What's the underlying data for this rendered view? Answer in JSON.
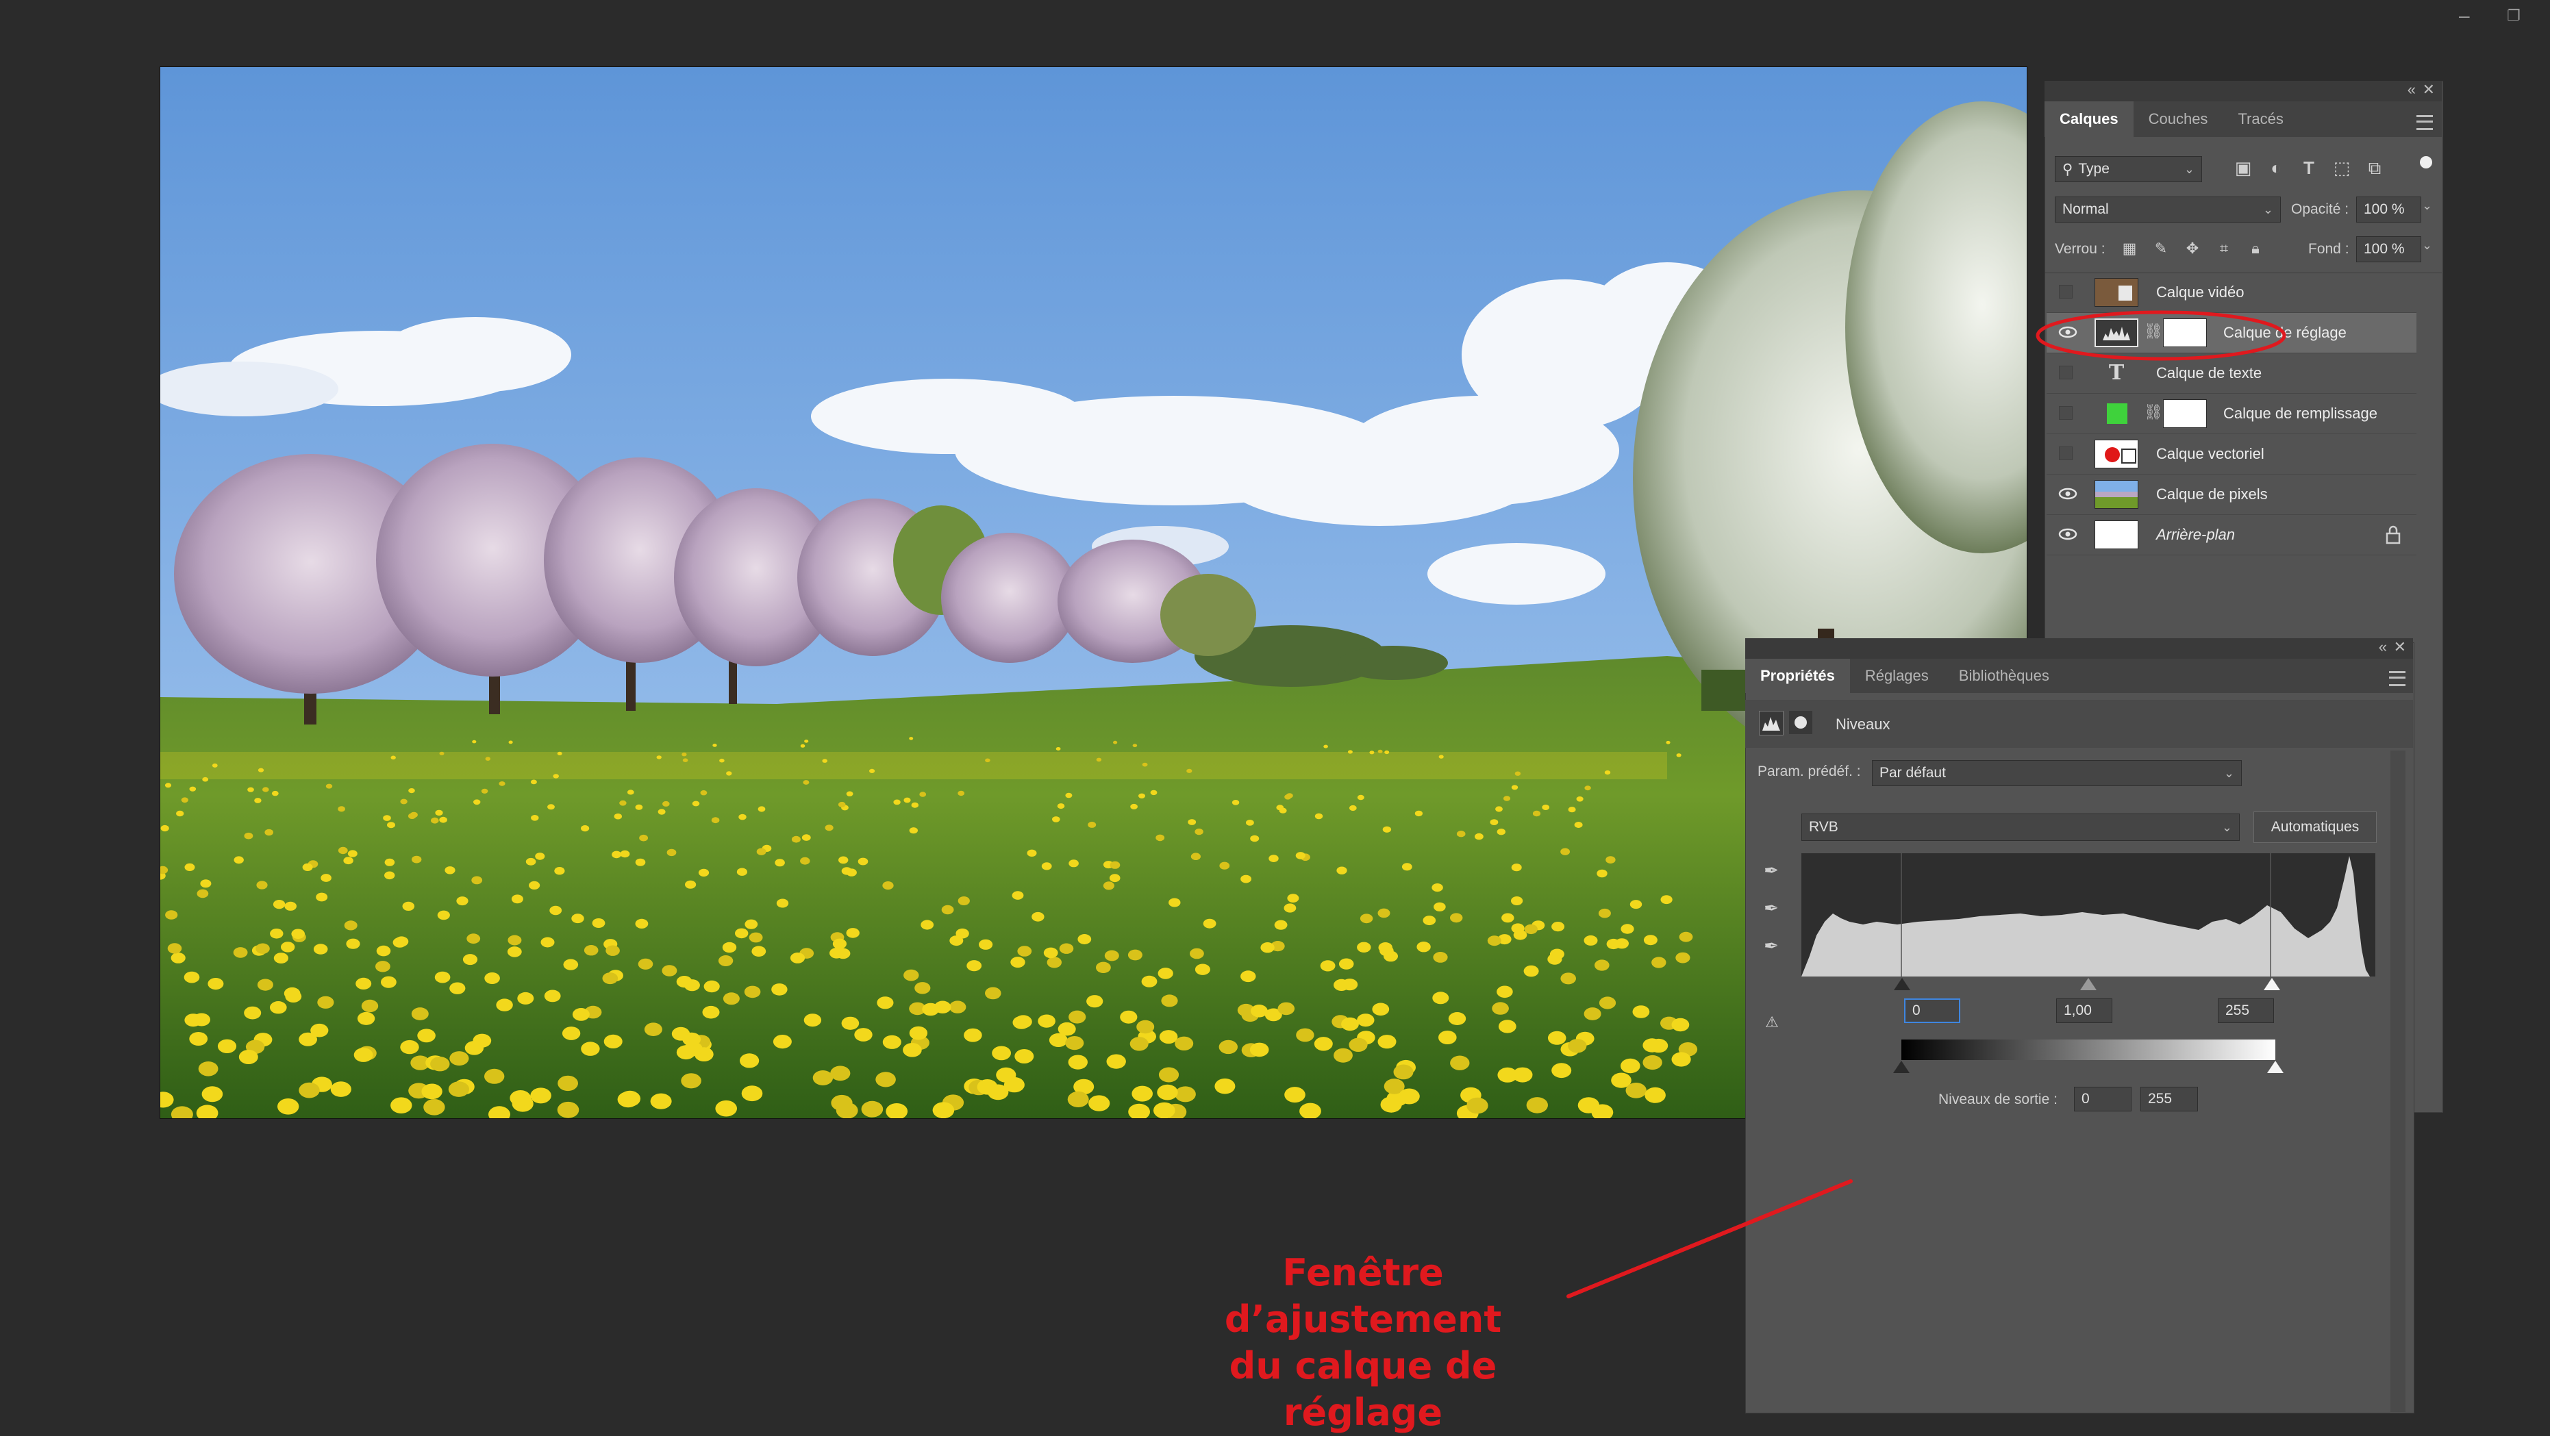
{
  "layers_panel": {
    "tabs": [
      "Calques",
      "Couches",
      "Tracés"
    ],
    "filter_label": "Type",
    "blend_mode": "Normal",
    "opacity_label": "Opacité :",
    "opacity_value": "100 %",
    "lock_label": "Verrou :",
    "fill_label": "Fond :",
    "fill_value": "100 %",
    "layers": [
      {
        "name": "Calque vidéo",
        "visible": false,
        "thumb": "video"
      },
      {
        "name": "Calque de réglage",
        "visible": true,
        "thumb": "levels",
        "mask": true,
        "selected": true
      },
      {
        "name": "Calque de texte",
        "visible": false,
        "thumb": "text"
      },
      {
        "name": "Calque de remplissage",
        "visible": false,
        "thumb": "fill",
        "mask": true
      },
      {
        "name": "Calque vectoriel",
        "visible": false,
        "thumb": "vector"
      },
      {
        "name": "Calque de pixels",
        "visible": true,
        "thumb": "pixels"
      },
      {
        "name": "Arrière-plan",
        "visible": true,
        "thumb": "white",
        "locked": true
      }
    ]
  },
  "properties_panel": {
    "tabs": [
      "Propriétés",
      "Réglages",
      "Bibliothèques"
    ],
    "adjustment_title": "Niveaux",
    "preset_label": "Param. prédéf. :",
    "preset_value": "Par défaut",
    "channel": "RVB",
    "auto_button": "Automatiques",
    "input_black": "0",
    "input_gamma": "1,00",
    "input_white": "255",
    "output_label": "Niveaux de sortie :",
    "output_black": "0",
    "output_white": "255"
  },
  "annotation": {
    "line1": "Fenêtre d’ajustement",
    "line2": "du calque de réglage",
    "color": "#e0191e"
  }
}
